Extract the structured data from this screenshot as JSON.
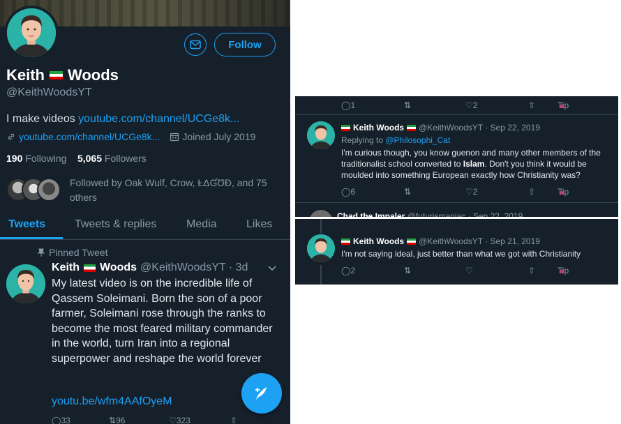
{
  "profile": {
    "follow_label": "Follow",
    "name_first": "Keith",
    "name_last": "Woods",
    "handle": "@KeithWoodsYT",
    "bio_prefix": "I make videos ",
    "bio_link": "youtube.com/channel/UCGe8k...",
    "website": "youtube.com/channel/UCGe8k...",
    "joined": "Joined July 2019",
    "following_count": "190",
    "following_label": "Following",
    "followers_count": "5,065",
    "followers_label": "Followers",
    "followed_by": "Followed by Oak Wulf, Crow, ȽΔƓƱÐ, and 75 others"
  },
  "tabs": [
    "Tweets",
    "Tweets & replies",
    "Media",
    "Likes"
  ],
  "pinned": {
    "label": "Pinned Tweet",
    "name_first": "Keith",
    "name_last": "Woods",
    "handle_time": "@KeithWoodsYT · 3d",
    "text": "My latest video is on the incredible life of Qassem Soleimani. Born the son of a poor farmer, Soleimani rose through the ranks to become the most feared military commander in the world, turn Iran into a regional superpower and reshape the world forever",
    "link": "youtu.be/wfm4AAfOyeM",
    "actions": [
      "33",
      "96",
      "323"
    ]
  },
  "reply1": {
    "top_actions": [
      "1",
      "",
      "2"
    ],
    "name": "Keith Woods",
    "handle_time": "@KeithWoodsYT · Sep 22, 2019",
    "replying_prefix": "Replying to ",
    "replying_handle": "@Philosophi_Cat",
    "text_before": "I'm curious though, you know guenon and many other members of the traditionalist school converted to ",
    "text_bold": "Islam",
    "text_after": ". Don't you think it would be moulded into something European exactly how Christianity was?",
    "actions": [
      "6",
      "",
      "2"
    ],
    "tip": "Tip",
    "cut_name": "Chad the Impaler",
    "cut_meta": "@futurismaniac · Sep 22, 2019"
  },
  "reply2": {
    "name": "Keith Woods",
    "handle_time": "@KeithWoodsYT · Sep 21, 2019",
    "text": "I'm not saying ideal, just better than what we got with Christianity",
    "actions": [
      "2",
      "",
      ""
    ],
    "tip": "Tip"
  },
  "colors": {
    "background": "#15202b",
    "accent": "#1da1f2",
    "muted": "#8899a6",
    "tip": "#e0245e"
  },
  "icons": [
    "mail-icon",
    "link-icon",
    "calendar-icon",
    "pin-icon",
    "chevron-down-icon",
    "reply-icon",
    "retweet-icon",
    "like-icon",
    "share-icon",
    "tip-icon",
    "compose-icon"
  ]
}
